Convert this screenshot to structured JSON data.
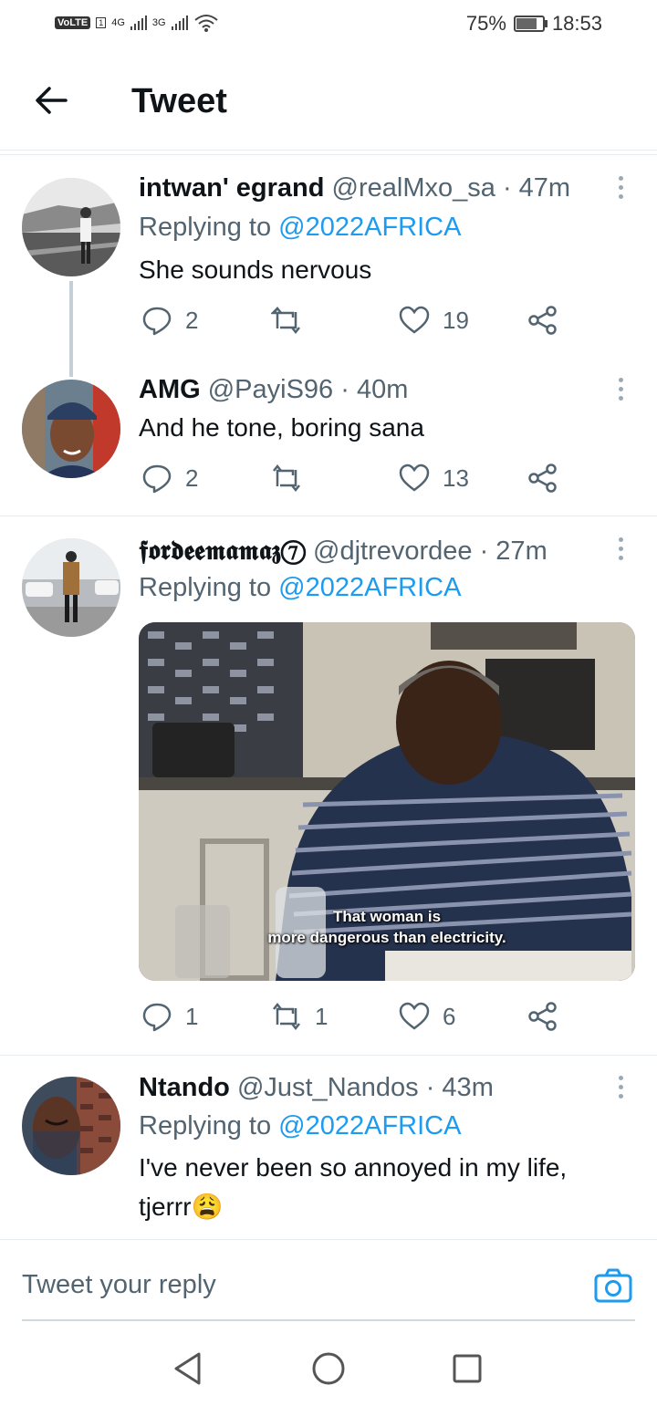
{
  "status_bar": {
    "volte": "VoLTE",
    "sim": "1",
    "net1": "4G",
    "net2": "3G",
    "battery": "75%",
    "time": "18:53"
  },
  "header": {
    "title": "Tweet"
  },
  "tweets": [
    {
      "name": "intwan' egrand",
      "handle": "@realMxo_sa",
      "time": "· 47m",
      "replying_prefix": "Replying to",
      "replying_to": "@2022AFRICA",
      "text": "She sounds nervous",
      "replies": "2",
      "retweets": "",
      "likes": "19"
    },
    {
      "name": "AMG",
      "handle": "@PayiS96",
      "time": "· 40m",
      "text": "And he tone, boring sana",
      "replies": "2",
      "retweets": "",
      "likes": "13"
    },
    {
      "name": "𝖋𝖔𝖗𝖉𝖊𝖊𝖒𝖆𝖒𝖆𝖟⑦",
      "handle": "@djtrevordee",
      "time": "· 27m",
      "replying_prefix": "Replying to",
      "replying_to": "@2022AFRICA",
      "media_caption_1": "That woman is",
      "media_caption_2": "more dangerous than electricity.",
      "replies": "1",
      "retweets": "1",
      "likes": "6"
    },
    {
      "name": "Ntando",
      "handle": "@Just_Nandos",
      "time": "· 43m",
      "replying_prefix": "Replying to",
      "replying_to": "@2022AFRICA",
      "text_line1": "I've never been so annoyed in my life,",
      "text_line2": "tjerrr😩"
    }
  ],
  "compose": {
    "placeholder": "Tweet your reply"
  },
  "colors": {
    "accent": "#1d9bf0",
    "muted": "#536471",
    "divider": "#e6ecf0"
  },
  "icons": [
    "back-arrow-icon",
    "reply-icon",
    "retweet-icon",
    "like-icon",
    "share-icon",
    "more-icon",
    "camera-icon",
    "nav-back-icon",
    "nav-home-icon",
    "nav-recents-icon"
  ]
}
